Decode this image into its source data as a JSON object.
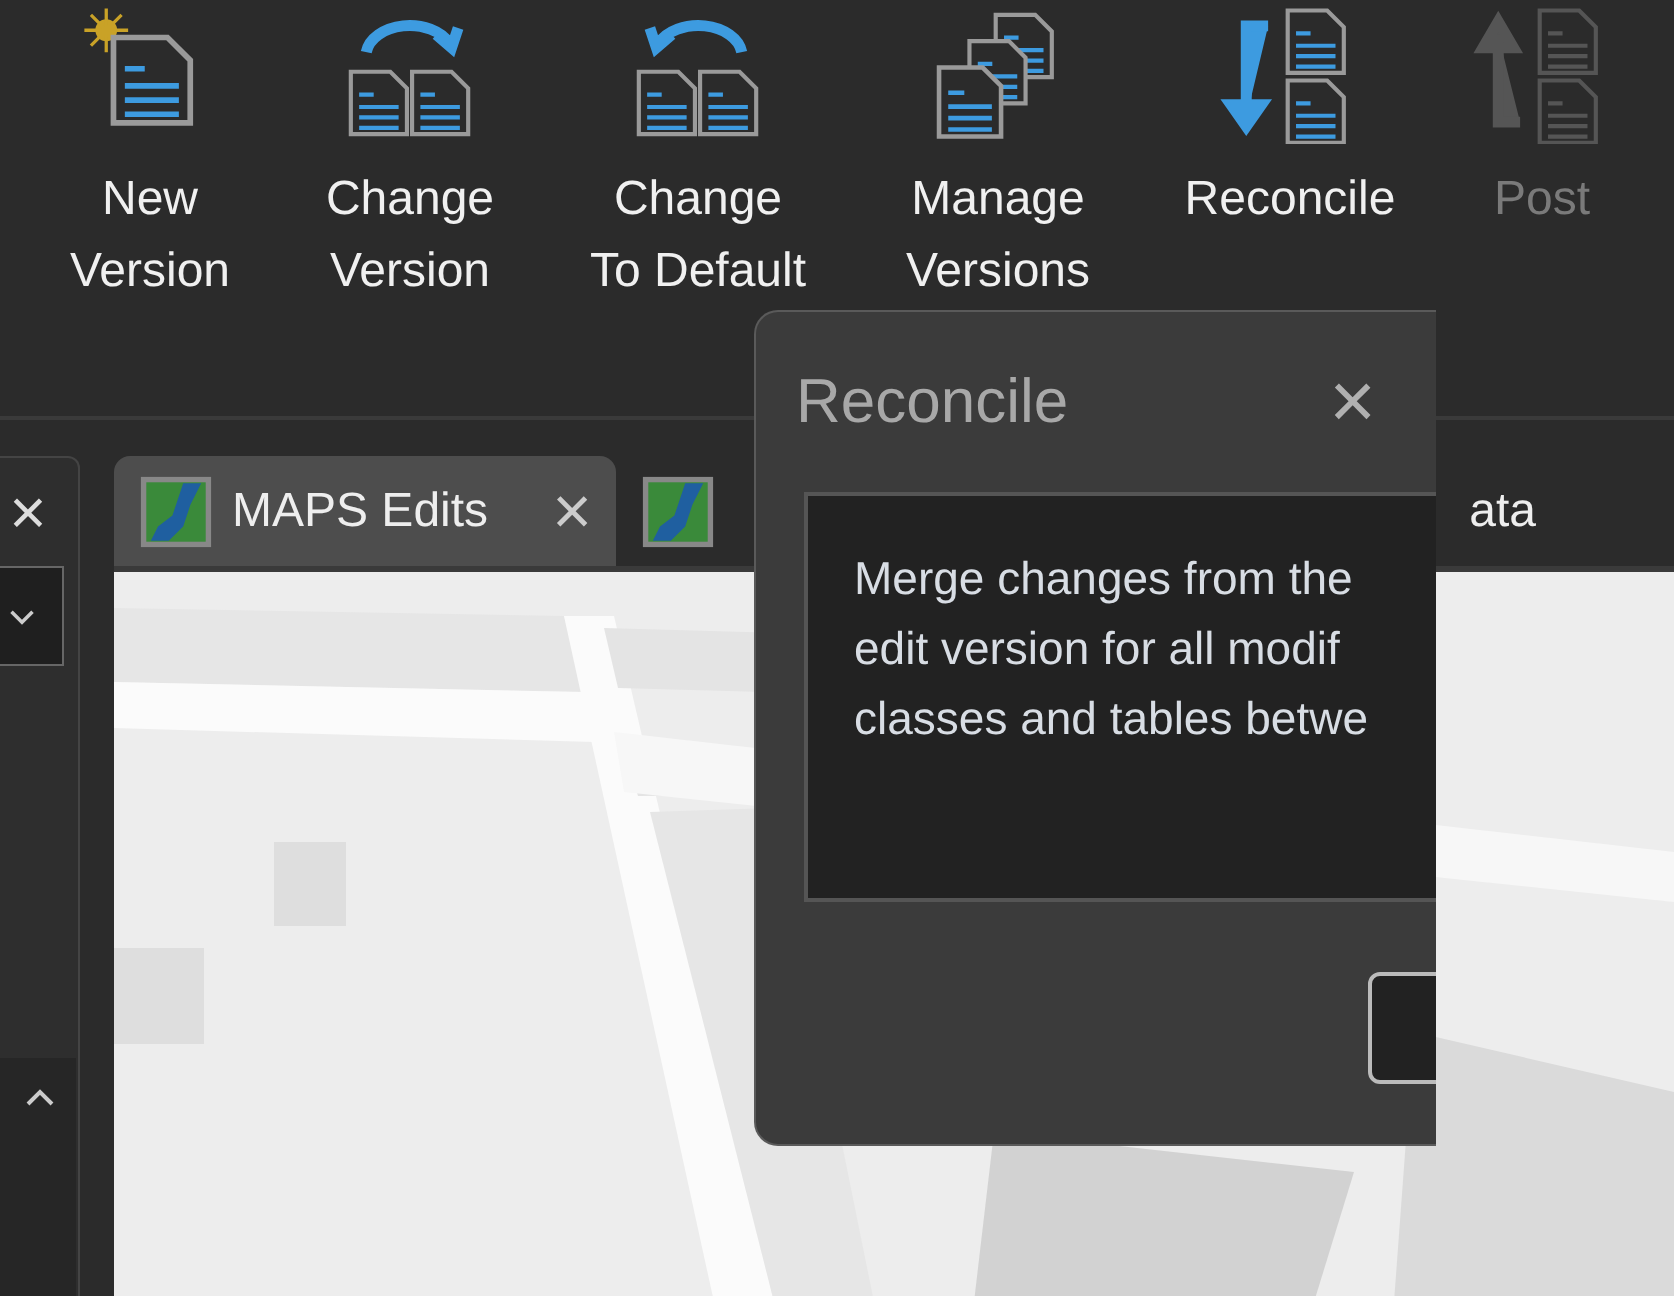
{
  "ribbon": {
    "buttons": [
      {
        "label": [
          "New",
          "Version"
        ],
        "disabled": false
      },
      {
        "label": [
          "Change",
          "Version"
        ],
        "disabled": false
      },
      {
        "label": [
          "Change",
          "To Default"
        ],
        "disabled": false
      },
      {
        "label": [
          "Manage",
          "Versions"
        ],
        "disabled": false
      },
      {
        "label": [
          "Reconcile"
        ],
        "disabled": false
      },
      {
        "label": [
          "Post"
        ],
        "disabled": true
      }
    ]
  },
  "side_panel": {
    "close": "×"
  },
  "tabs": [
    {
      "label": "MAPS Edits",
      "close": "×",
      "selected": true
    },
    {
      "label": "ata",
      "selected": false
    }
  ],
  "tooltip": {
    "title": "Reconcile",
    "close": "×",
    "lines": [
      "Merge changes from the",
      "edit version for all modif",
      "classes and tables betwe"
    ]
  }
}
